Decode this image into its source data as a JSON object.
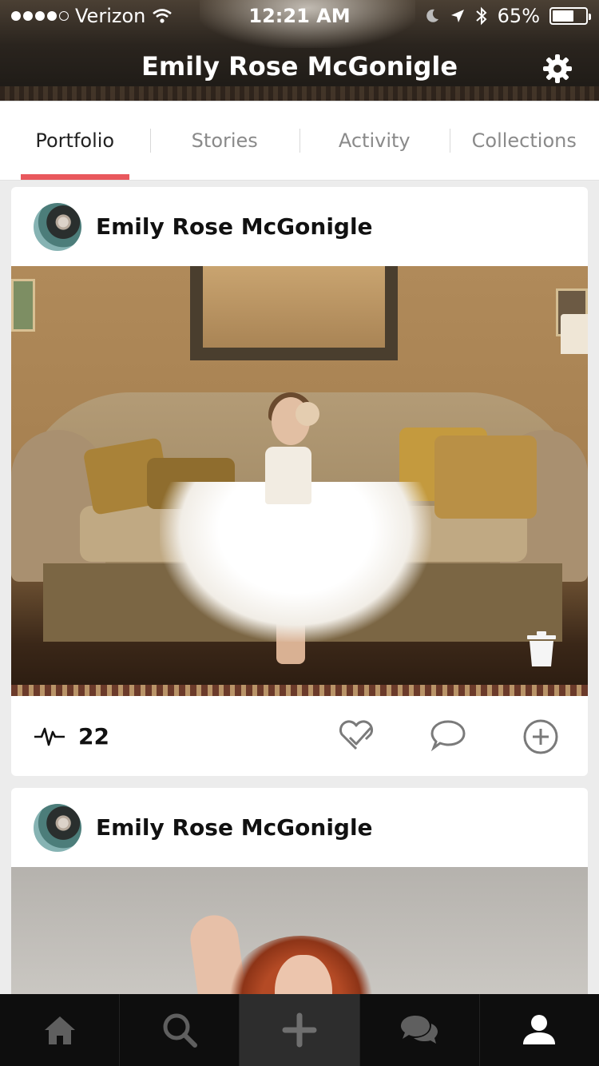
{
  "status_bar": {
    "carrier": "Verizon",
    "time": "12:21 AM",
    "battery": "65%",
    "battery_level": 0.65,
    "signal_bars_filled": 4,
    "signal_bars_total": 5
  },
  "header": {
    "title": "Emily Rose McGonigle",
    "settings_icon": "gear-icon"
  },
  "tabs": [
    {
      "label": "Portfolio",
      "active": true
    },
    {
      "label": "Stories",
      "active": false
    },
    {
      "label": "Activity",
      "active": false
    },
    {
      "label": "Collections",
      "active": false
    }
  ],
  "posts": [
    {
      "author": "Emily Rose McGonigle",
      "pulse_count": "22",
      "actions": [
        "pulse-icon",
        "like-heart-icon",
        "comment-icon",
        "add-to-collection-icon",
        "trash-icon"
      ]
    },
    {
      "author": "Emily Rose McGonigle"
    }
  ],
  "bottom_nav": [
    {
      "icon": "home-icon"
    },
    {
      "icon": "search-icon"
    },
    {
      "icon": "plus-icon"
    },
    {
      "icon": "chat-icon"
    },
    {
      "icon": "profile-icon",
      "active": true
    }
  ],
  "colors": {
    "accent": "#e9585d",
    "tab_inactive": "#8a8a8a",
    "nav_background": "#0e0e0e",
    "nav_icon": "#5f5f5f"
  }
}
